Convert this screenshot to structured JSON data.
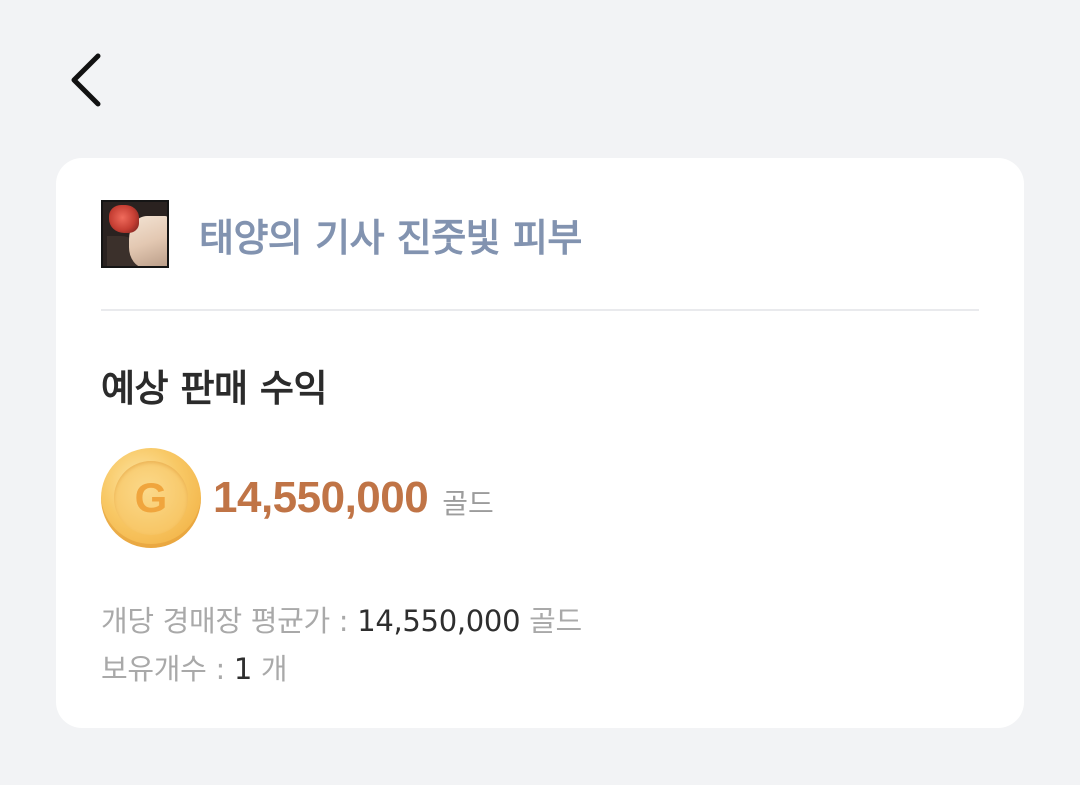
{
  "header": {
    "back_icon": "chevron-left-icon"
  },
  "item": {
    "name": "태양의 기사 진줏빛 피부",
    "thumbnail": "item-skin-thumbnail"
  },
  "earnings": {
    "section_title": "예상 판매 수익",
    "coin_letter": "G",
    "amount": "14,550,000",
    "unit": "골드",
    "amount_color": "#c07446"
  },
  "details": {
    "avg_price_label": "개당 경매장 평균가 : ",
    "avg_price_value": "14,550,000",
    "avg_price_unit": " 골드",
    "owned_label": "보유개수 : ",
    "owned_value": "1",
    "owned_unit": " 개"
  }
}
